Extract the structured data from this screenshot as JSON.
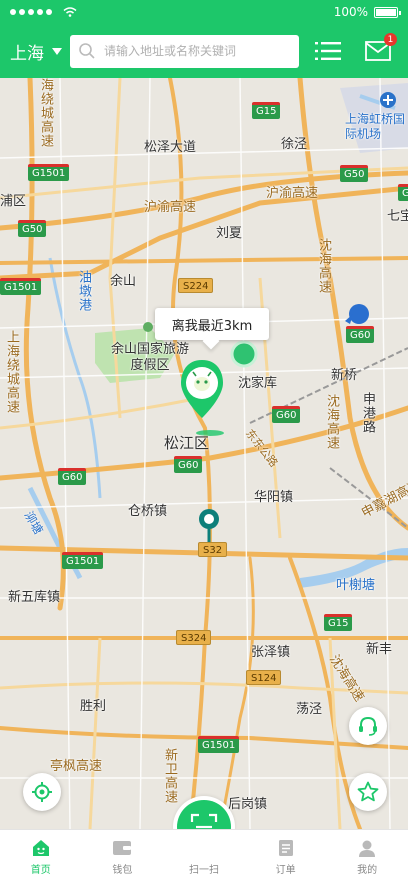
{
  "status_bar": {
    "battery": "100%"
  },
  "header": {
    "city": "上海",
    "search_placeholder": "请输入地址或名称关键词",
    "badge_count": "1"
  },
  "map": {
    "tooltip": "离我最近3km",
    "places": [
      "松泽大道",
      "徐泾",
      "上海虹桥国际机场",
      "浦区",
      "沪渝高速",
      "沪渝高速",
      "七宝",
      "刘夏",
      "余山",
      "油墩港",
      "余山国家旅游度假区",
      "沈家库",
      "新桥",
      "上海绕城高速",
      "松江区",
      "申港路",
      "华阳镇",
      "仓桥镇",
      "新五库镇",
      "叶榭塘",
      "张泽镇",
      "新丰",
      "胜利",
      "荡泾",
      "亭枫高速",
      "新卫高速",
      "后岗镇",
      "沈海高速",
      "沈海高速",
      "申嘉湖高速",
      "东东公路",
      "泖塘",
      "沈海高速",
      "海绕城高速"
    ],
    "shields": [
      "G15",
      "G1501",
      "G50",
      "G50",
      "G50",
      "G1501",
      "S224",
      "G60",
      "G60",
      "G60",
      "G60",
      "S32",
      "G1501",
      "G15",
      "S324",
      "S124",
      "G1501"
    ]
  },
  "tabs": [
    {
      "label": "首页",
      "icon": "home-icon",
      "active": true
    },
    {
      "label": "钱包",
      "icon": "wallet-icon",
      "active": false
    },
    {
      "label": "扫一扫",
      "icon": "scan-icon",
      "active": false
    },
    {
      "label": "订单",
      "icon": "order-icon",
      "active": false
    },
    {
      "label": "我的",
      "icon": "profile-icon",
      "active": false
    }
  ],
  "colors": {
    "brand": "#1dc76a",
    "badge": "#e8372c",
    "teal_pin": "#0d7f7a"
  }
}
